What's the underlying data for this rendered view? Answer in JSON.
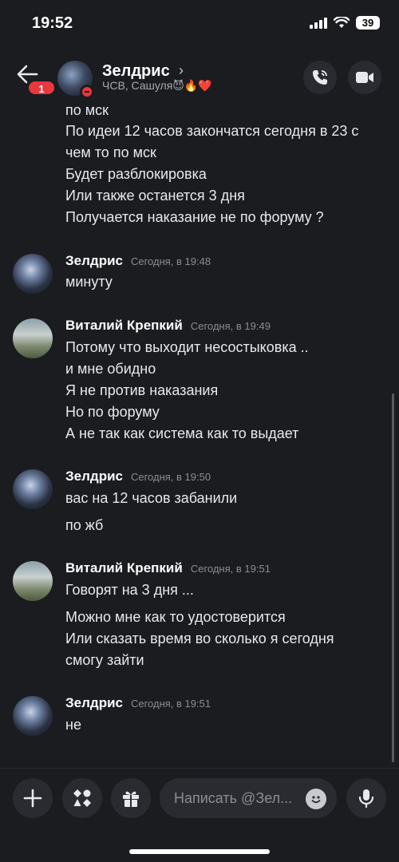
{
  "status_bar": {
    "time": "19:52",
    "battery": "39"
  },
  "header": {
    "badge": "1",
    "name": "Зелдрис",
    "chevron": "›",
    "subtitle": "ЧСВ, Сашуля😈🔥❤️"
  },
  "messages": {
    "prev_lines": [
      "по мск",
      "По идеи 12 часов закончатся сегодня в 23 с",
      "чем то по мск",
      "Будет разблокировка",
      "Или также останется 3 дня",
      "Получается наказание не по форуму ?"
    ],
    "groups": [
      {
        "author": "Зелдрис",
        "timestamp": "Сегодня, в 19:48",
        "lines": [
          "минуту"
        ]
      },
      {
        "author": "Виталий Крепкий",
        "timestamp": "Сегодня, в 19:49",
        "lines": [
          "Потому что выходит несостыковка ..",
          "и мне обидно",
          "Я не против наказания",
          "Но по форуму",
          "А не так как система как то выдает"
        ]
      },
      {
        "author": "Зелдрис",
        "timestamp": "Сегодня, в 19:50",
        "lines": [
          "вас на 12 часов забанили",
          "по жб"
        ]
      },
      {
        "author": "Виталий Крепкий",
        "timestamp": "Сегодня, в 19:51",
        "lines": [
          "Говорят на 3 дня ...",
          "Можно мне как то удостоверится",
          "Или сказать время во сколько я сегодня",
          "смогу зайти"
        ]
      },
      {
        "author": "Зелдрис",
        "timestamp": "Сегодня, в 19:51",
        "lines": [
          "не"
        ]
      }
    ]
  },
  "composer": {
    "placeholder": "Написать @Зел..."
  },
  "colors": {
    "background": "#1b1c20",
    "button": "#2a2b31",
    "badge": "#e8373d",
    "text": "#e8e9ec",
    "muted": "#8b8d95"
  }
}
